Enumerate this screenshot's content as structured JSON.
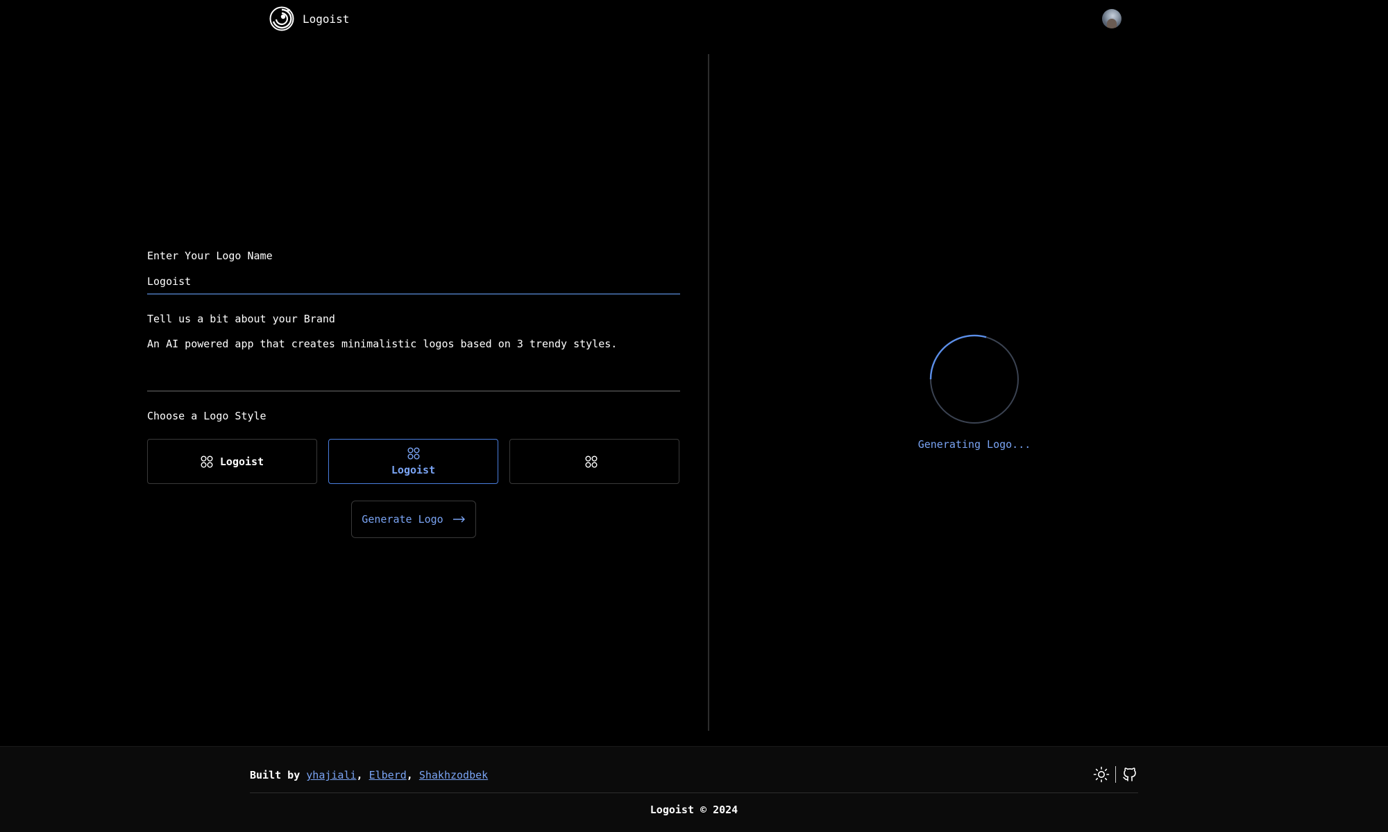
{
  "header": {
    "app_name": "Logoist",
    "logo_icon": "logoist-swirl-icon",
    "avatar_icon": "user-avatar"
  },
  "form": {
    "name_label": "Enter Your Logo Name",
    "name_value": "Logoist",
    "brand_label": "Tell us a bit about your Brand",
    "brand_value": "An AI powered app that creates minimalistic logos based on 3 trendy styles.",
    "style_label": "Choose a Logo Style",
    "styles": [
      {
        "label": "Logoist",
        "icon": "grid-four-circles-icon",
        "selected": false
      },
      {
        "label": "Logoist",
        "icon": "grid-four-circles-icon",
        "selected": true
      },
      {
        "label": "",
        "icon": "grid-four-circles-icon",
        "selected": false
      }
    ],
    "generate_label": "Generate Logo",
    "generate_icon": "arrow-right-icon"
  },
  "preview": {
    "status": "Generating Logo..."
  },
  "footer": {
    "built_by": "Built by",
    "authors": [
      "yhajiali",
      "Elberd",
      "Shakhzodbek"
    ],
    "copyright": "Logoist © 2024",
    "icons": [
      "sun-icon",
      "github-icon"
    ]
  },
  "colors": {
    "background": "#000000",
    "accent": "#7aa4f4",
    "selected_border": "#4a7fe0"
  }
}
